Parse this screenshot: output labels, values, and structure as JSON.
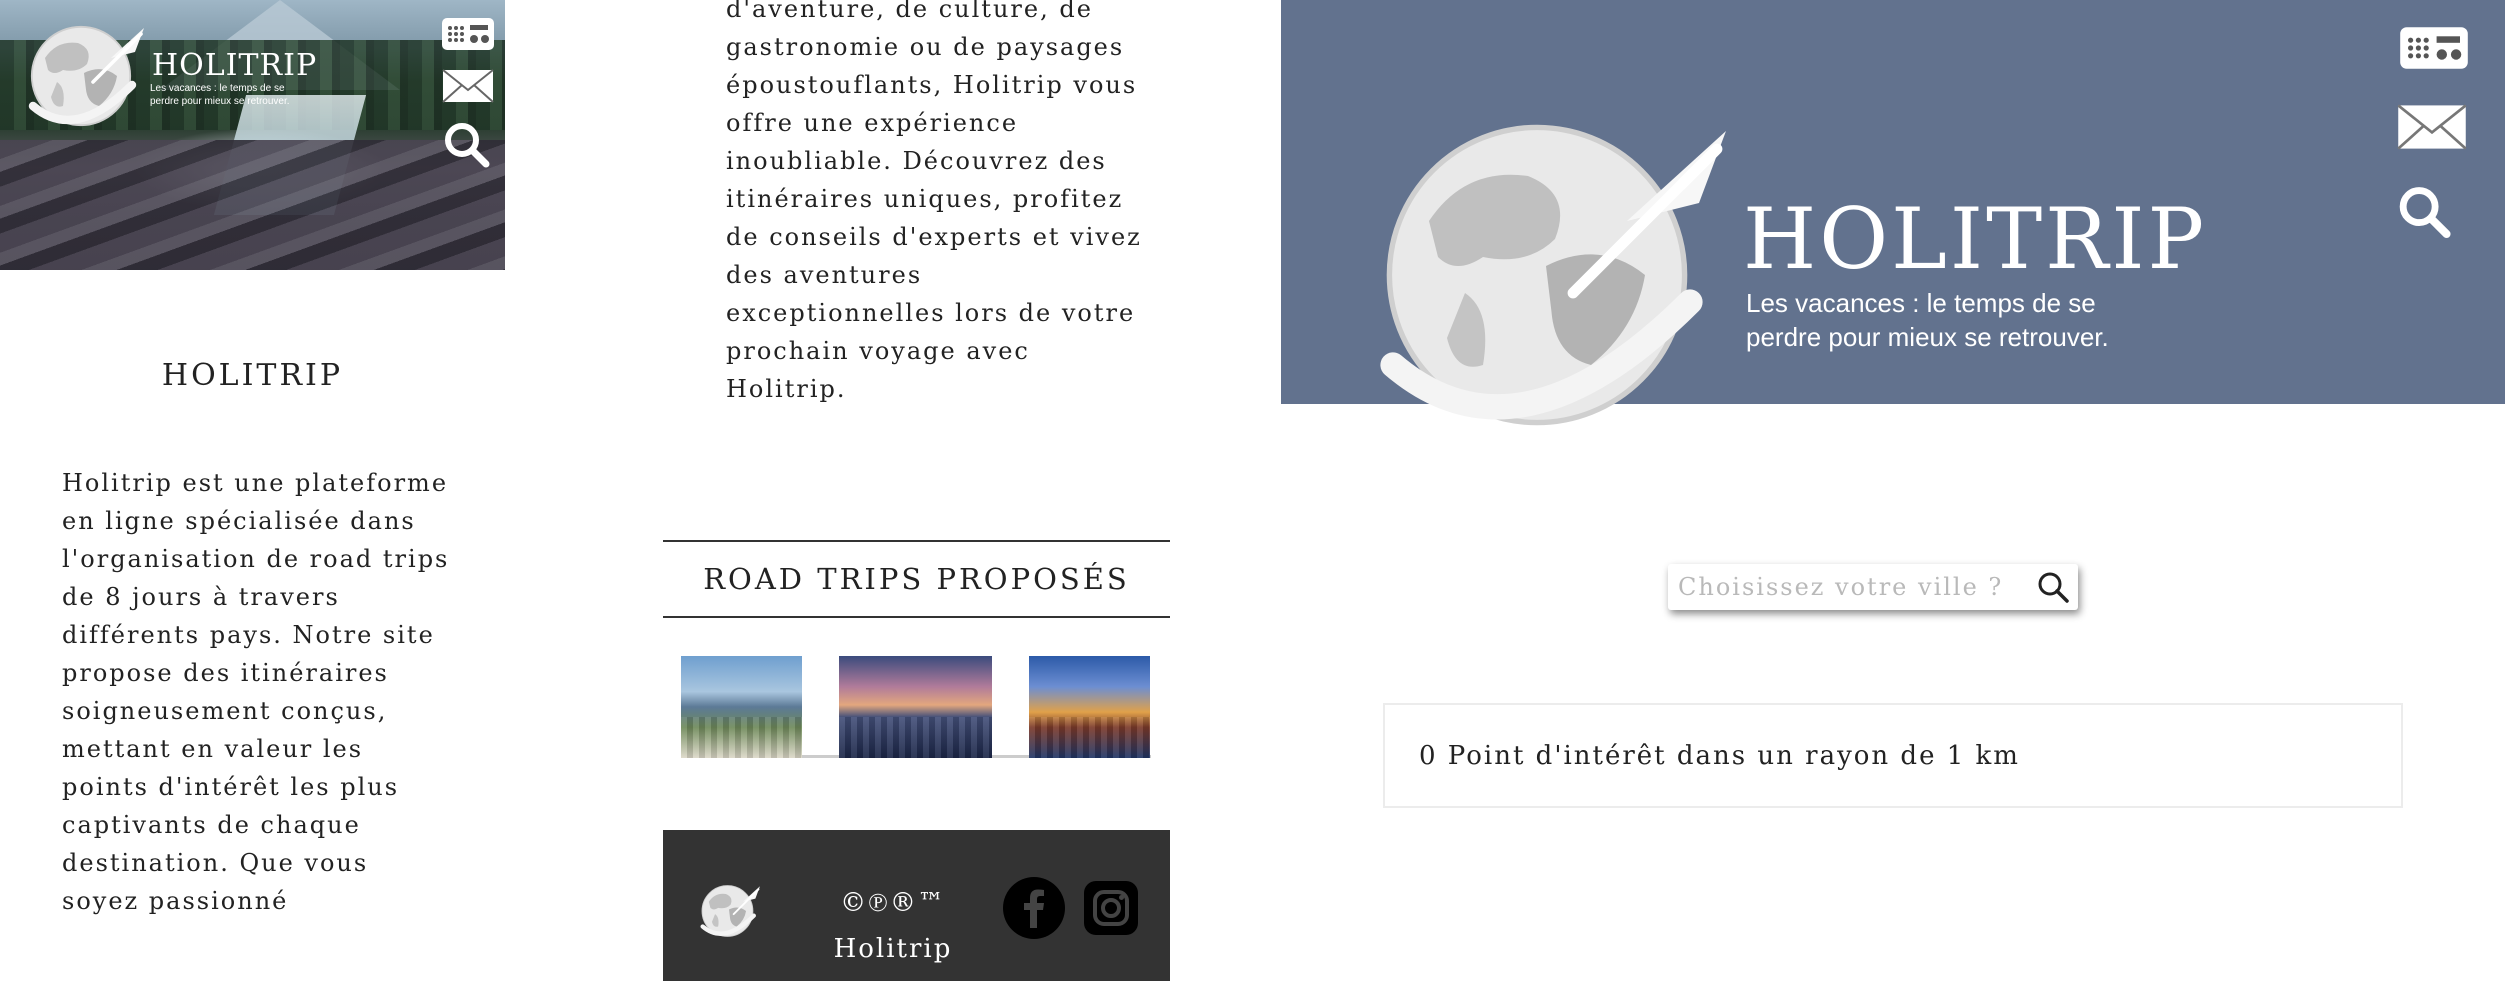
{
  "brand": {
    "name": "HOLITRIP",
    "tagline_line1": "Les vacances : le temps de se",
    "tagline_line2": "perdre pour mieux se retrouver."
  },
  "header_icons": [
    "radio-icon",
    "mail-icon",
    "search-icon"
  ],
  "mobile_left": {
    "section_title": "HOLITRIP",
    "intro_text": "Holitrip est une plateforme en ligne spécialisée dans l'organisation de road trips de 8 jours à travers différents pays. Notre site propose des itinéraires soigneusement conçus, mettant en valeur les points d'intérêt les plus captivants de chaque destination. Que vous soyez passionné"
  },
  "mobile_middle": {
    "intro_continued": "d'aventure, de culture, de gastronomie ou de paysages époustouflants, Holitrip vous offre une expérience inoubliable. Découvrez des itinéraires uniques, profitez de conseils d'experts et vivez des aventures exceptionnelles lors de votre prochain voyage avec Holitrip.",
    "road_trips_title": "ROAD TRIPS PROPOSÉS",
    "road_trip_thumbnails": [
      "rio-de-janeiro-thumbnail",
      "sydney-opera-thumbnail",
      "city-skyline-thumbnail"
    ],
    "footer": {
      "copyright_symbols": "©℗®™",
      "copyright_name": "Holitrip",
      "social": [
        "facebook-icon",
        "instagram-icon"
      ]
    }
  },
  "desktop": {
    "search": {
      "placeholder": "Choisissez votre ville ?",
      "value": ""
    },
    "poi_result": "0 Point d'intérêt dans un rayon de 1 km"
  },
  "colors": {
    "header_background": "#62728e",
    "footer_background": "#333333",
    "text": "#222222"
  }
}
